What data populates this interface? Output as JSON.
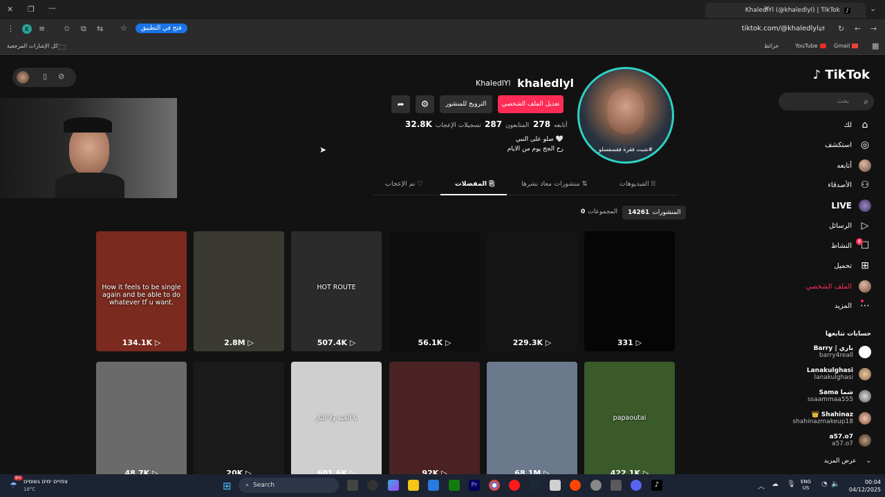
{
  "browser": {
    "tab_title": "KhaledlYl (@khaledlyl) | TikTok",
    "url": "tiktok.com/@khaledlyl",
    "open_in_app": "فتح في التطبيق",
    "bookmarks": [
      "Gmail",
      "YouTube",
      "خرائط"
    ],
    "all_bookmarks": "كل الإشارات المرجعية"
  },
  "sidebar": {
    "logo": "TikTok",
    "search_placeholder": "بحث",
    "items": [
      {
        "label": "لك",
        "icon": "home-icon"
      },
      {
        "label": "استكشف",
        "icon": "compass-icon"
      },
      {
        "label": "أتابعه",
        "icon": "avatar"
      },
      {
        "label": "الأصدقاء",
        "icon": "friends-icon"
      },
      {
        "label": "LIVE",
        "icon": "live-icon"
      },
      {
        "label": "الرسائل",
        "icon": "send-icon"
      },
      {
        "label": "النشاط",
        "icon": "inbox-icon",
        "badge": "6"
      },
      {
        "label": "تحميل",
        "icon": "upload-icon"
      },
      {
        "label": "الملف الشخصي",
        "icon": "profile-avatar"
      },
      {
        "label": "المزيد",
        "icon": "more-icon"
      }
    ],
    "following_title": "حسابات تتابعها",
    "following": [
      {
        "name": "Barry | باري",
        "handle": "barry4reall"
      },
      {
        "name": "Lanakulghasi",
        "handle": "lanakulghasi"
      },
      {
        "name": "Sama شما",
        "handle": "ssaammaa555"
      },
      {
        "name": "Shahinaz",
        "handle": "shahinazmakeup18"
      },
      {
        "name": "a57.o7",
        "handle": "a57.o7"
      }
    ],
    "see_more": "عرض المزيد"
  },
  "profile": {
    "username": "khaledlyl",
    "nickname": "KhaledlYl",
    "edit_button": "تعديل الملف الشخصي",
    "promote_button": "الترويج للمنشور",
    "following_count": "278",
    "following_label": "أتابعه",
    "followers_count": "287",
    "followers_label": "المتابعون",
    "likes_count": "32.8K",
    "likes_label": "تسجيلات الإعجاب",
    "bio_line1": "صلو على النبي 🤍",
    "bio_line2": "رح الجج يوم من الايام",
    "avatar_caption": "شبت فقرة فقسفسلو#"
  },
  "tabs": {
    "videos": "الفيديوهات",
    "reposts": "منشورات معاد نشرها",
    "favorites": "المفضلات",
    "liked": "تم الإعجاب"
  },
  "subtabs": {
    "posts_label": "المنشورات",
    "posts_count": "14261",
    "collections_label": "المجموعات",
    "collections_count": "0"
  },
  "videos": [
    {
      "views": "134.1K",
      "caption": "How it feels to be single again and be able to do whatever tf u want.",
      "bg": "#7a2a1e"
    },
    {
      "views": "2.8M",
      "caption": "",
      "bg": "#3b3a32"
    },
    {
      "views": "507.4K",
      "caption": "HOT ROUTE",
      "bg": "#2b2b2b"
    },
    {
      "views": "56.1K",
      "caption": "",
      "bg": "#0e0e0e"
    },
    {
      "views": "229.3K",
      "caption": "",
      "bg": "#151515"
    },
    {
      "views": "331",
      "caption": "",
      "bg": "#050505"
    },
    {
      "views": "48.7K",
      "caption": "",
      "bg": "#6a6a6a"
    },
    {
      "views": "20K",
      "caption": "",
      "bg": "#1a1a1a"
    },
    {
      "views": "601.6K",
      "caption": "يا الجنة ولا النار",
      "bg": "#cfcfcf"
    },
    {
      "views": "92K",
      "caption": "",
      "bg": "#4a2224"
    },
    {
      "views": "68.1M",
      "caption": "",
      "bg": "#6a7a8c"
    },
    {
      "views": "422.1K",
      "caption": "papaoutai",
      "bg": "#3a5a2a"
    }
  ],
  "taskbar": {
    "weather_temp": "18°C",
    "weather_text": "צפויים ימים גשומים",
    "search": "Search",
    "lang1": "ENG",
    "lang2": "US",
    "time": "00:04",
    "date": "04/12/2025",
    "notif_badge": "9+"
  }
}
